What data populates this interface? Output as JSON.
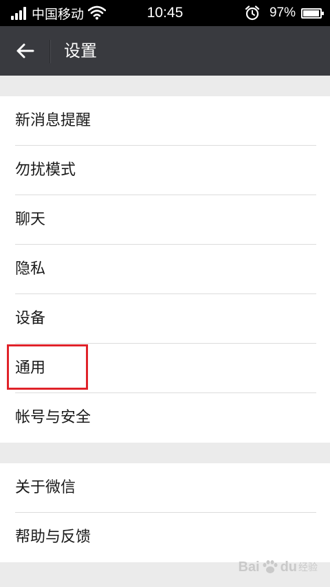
{
  "status_bar": {
    "carrier": "中国移动",
    "time": "10:45",
    "battery_percent": "97%",
    "battery_level": 0.97,
    "icons": [
      "signal-icon",
      "wifi-icon",
      "alarm-icon",
      "battery-icon"
    ]
  },
  "header": {
    "back_icon": "back-arrow-icon",
    "title": "设置"
  },
  "settings": {
    "group1": [
      {
        "label": "新消息提醒"
      },
      {
        "label": "勿扰模式"
      },
      {
        "label": "聊天"
      },
      {
        "label": "隐私"
      },
      {
        "label": "设备"
      },
      {
        "label": "通用",
        "highlighted": true
      },
      {
        "label": "帐号与安全"
      }
    ],
    "group2": [
      {
        "label": "关于微信"
      },
      {
        "label": "帮助与反馈"
      }
    ]
  },
  "annotation": {
    "highlight_color": "#e02229"
  },
  "watermark": {
    "brand": "Bai",
    "brand2": "du",
    "sub": "经验"
  },
  "colors": {
    "header_bg": "#393a3f",
    "page_bg": "#ebebeb",
    "item_bg": "#ffffff"
  }
}
